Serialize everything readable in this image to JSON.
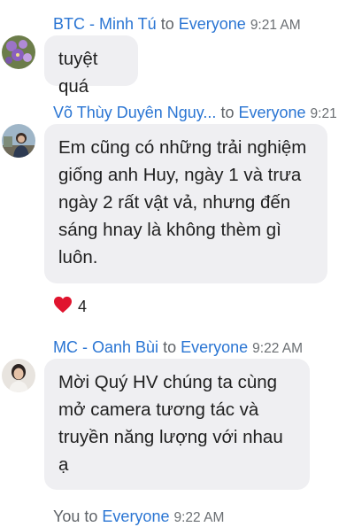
{
  "messages": [
    {
      "sender": "BTC - Minh Tú",
      "to": "to",
      "recipient": "Everyone",
      "time": "9:21 AM",
      "text": "tuyệt quá",
      "avatar": "purple-flowers-avatar"
    },
    {
      "sender": "Võ Thùy Duyên Nguy...",
      "to": "to",
      "recipient": "Everyone",
      "time": "9:21",
      "text": "Em cũng có những trải nghiệm giống anh Huy, ngày 1 và trưa ngày 2 rất vật vả, nhưng đến sáng hnay là không thèm gì luôn.",
      "avatar": "person-outdoor-avatar",
      "reaction": {
        "icon": "heart-icon",
        "count": "4",
        "color": "#e0142e"
      }
    },
    {
      "sender": "MC - Oanh Bùi",
      "to": "to",
      "recipient": "Everyone",
      "time": "9:22 AM",
      "text": "Mời Quý HV chúng ta cùng mở camera tương tác và truyền năng lượng với nhau ạ",
      "avatar": "woman-portrait-avatar"
    },
    {
      "sender": "You",
      "to": "to",
      "recipient": "Everyone",
      "time": "9:22 AM"
    }
  ],
  "colors": {
    "link": "#2a75d3",
    "bubble": "#efeff2",
    "time": "#6b6f73"
  }
}
